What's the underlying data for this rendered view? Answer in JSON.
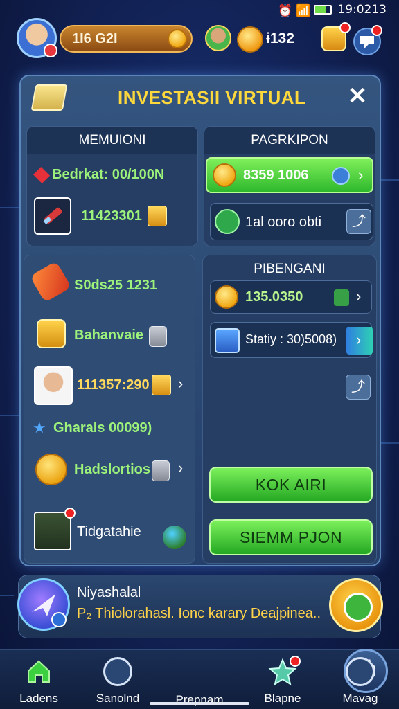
{
  "status_bar": {
    "time": "19:0213"
  },
  "top_bar": {
    "coin_balance": "1Ɩ6 G2I",
    "gem_count": "ɨ132"
  },
  "panel": {
    "title": "INVESTASII VIRTUAL",
    "left_top": {
      "header": "MEMUIONI",
      "row1": "Bedrkat: 00/100N",
      "row2": "11423301"
    },
    "right_top": {
      "header": "PAGRKIPON",
      "row1": "8359 1006",
      "row2": "1al ooro obti"
    },
    "left_list": [
      {
        "label": "S0ds25 1231"
      },
      {
        "label": "Bahanvaie"
      },
      {
        "label": "111357:290"
      },
      {
        "label": "Gharals 00099)"
      },
      {
        "label": "Hadslortios"
      },
      {
        "label": "Tidgatahie"
      }
    ],
    "right_bottom": {
      "header": "PIBENGANI",
      "row1": "135.0350",
      "row2": "Statiy : 30)5008)"
    },
    "btn_primary": "KOK AIRI",
    "btn_secondary": "SIEMM PJON"
  },
  "notice": {
    "title": "Niyashalal",
    "message": "P₂ Thiolorahasl. Ionc karary Deajpinea.."
  },
  "bottom_nav": [
    {
      "label": "Ladens"
    },
    {
      "label": "Sanolnd"
    },
    {
      "label": "Prepnam"
    },
    {
      "label": "Blapne"
    },
    {
      "label": "Mavag"
    }
  ],
  "colors": {
    "accent_green": "#3cc43a",
    "title_yellow": "#ffd83c",
    "panel_blue": "#2d4a74"
  }
}
